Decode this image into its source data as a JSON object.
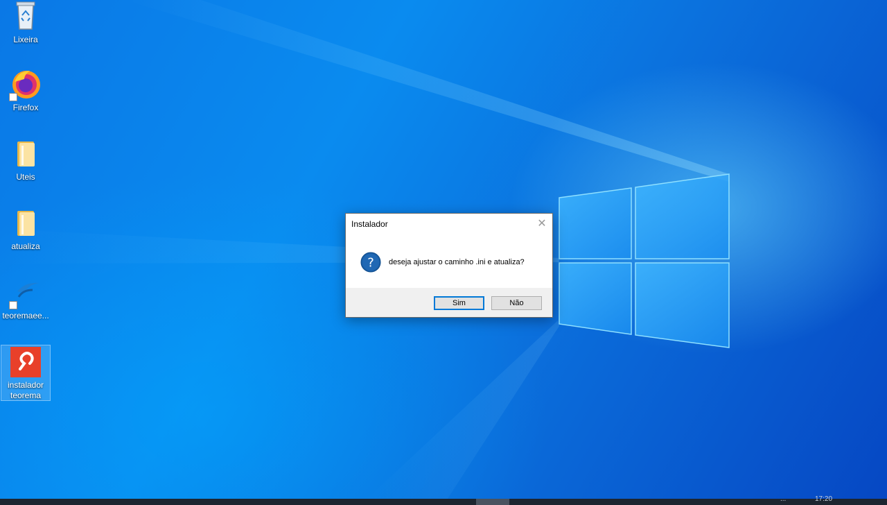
{
  "desktop": {
    "icons": [
      {
        "label": "Lixeira",
        "icon": "recycle-bin-icon"
      },
      {
        "label": "Firefox",
        "icon": "firefox-icon"
      },
      {
        "label": "Uteis",
        "icon": "folder-icon"
      },
      {
        "label": "atualiza",
        "icon": "folder-icon"
      },
      {
        "label": "teoremaee...",
        "icon": "teorema-shortcut-icon"
      },
      {
        "label": "instalador teorema",
        "label_line1": "instalador",
        "label_line2": "teorema",
        "icon": "instalador-app-icon"
      }
    ]
  },
  "dialog": {
    "title": "Instalador",
    "close_glyph": "✕",
    "message": "deseja ajustar o caminho .ini e atualiza?",
    "icon": "question-icon",
    "buttons": {
      "yes": "Sim",
      "no": "Não"
    }
  },
  "taskbar": {
    "clock": "17:20",
    "tray": "..."
  },
  "colors": {
    "accent": "#0078d7",
    "question_icon": "#1a5fa8",
    "app_icon_bg": "#e8402a"
  }
}
